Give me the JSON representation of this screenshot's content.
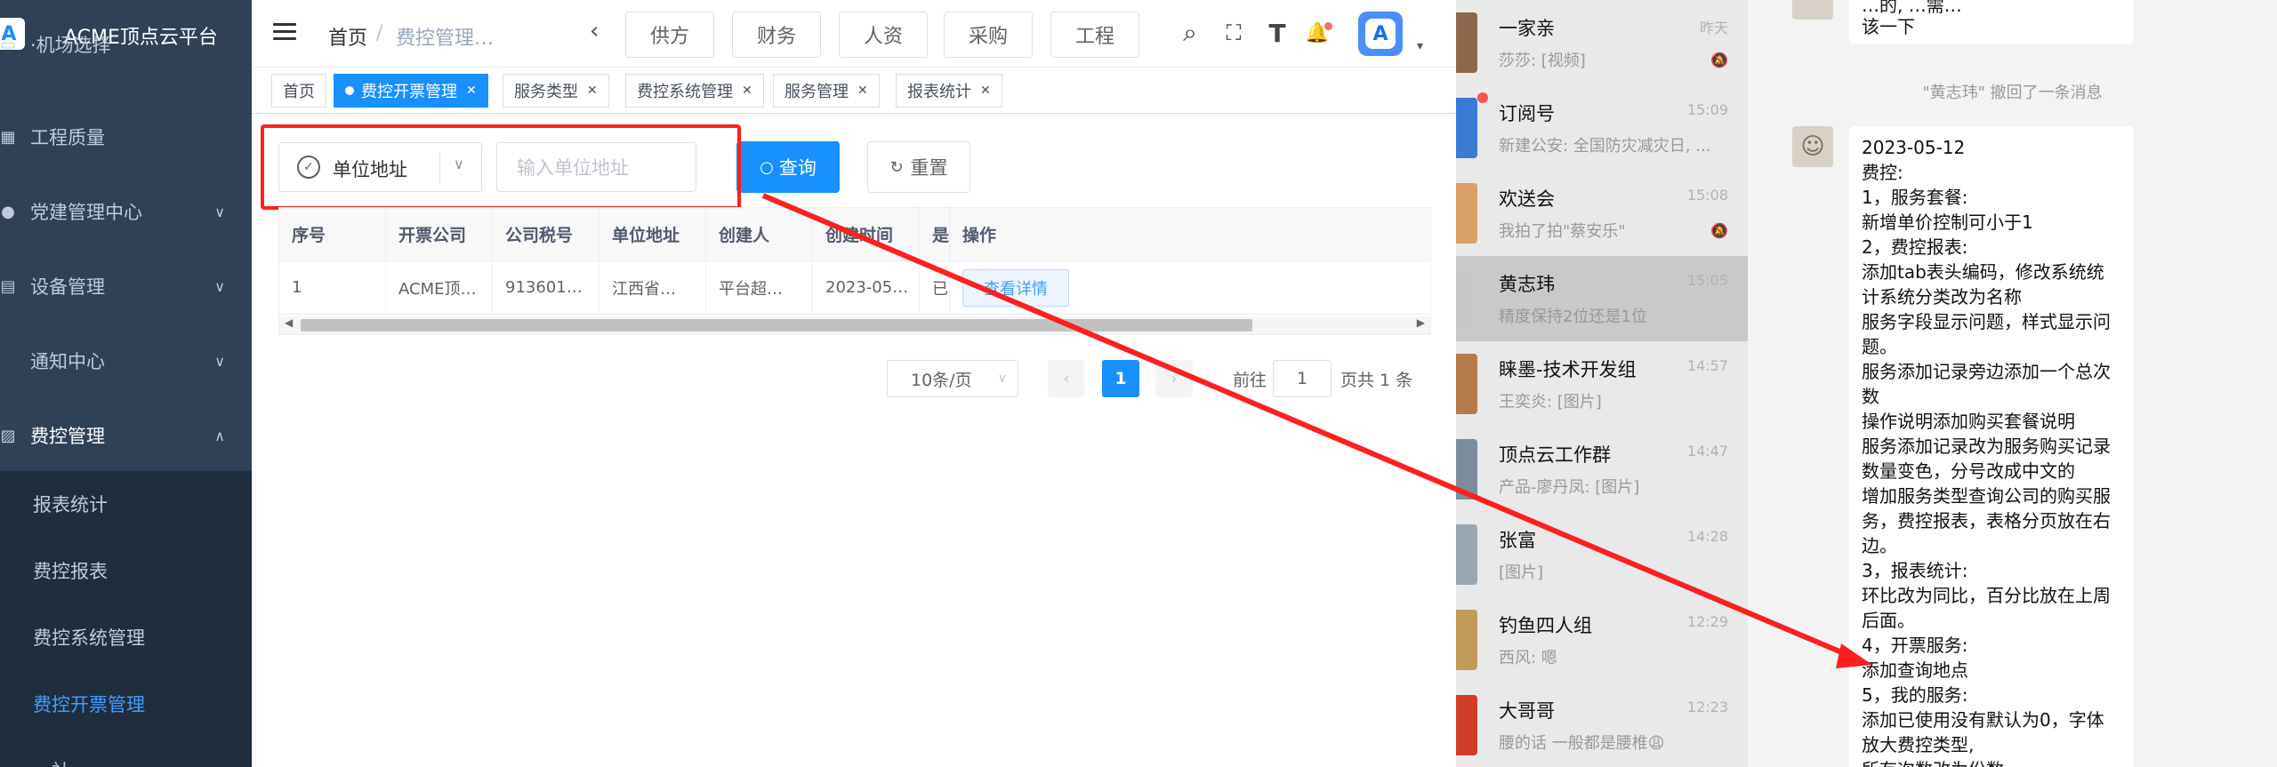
{
  "app": {
    "title": "ACME顶点云平台",
    "logo_text": "A"
  },
  "sidebar": {
    "items": [
      {
        "label": "·机场选择",
        "icon": "▭",
        "arrow": ""
      },
      {
        "label": "工程质量",
        "icon": "▦",
        "arrow": ""
      },
      {
        "label": "党建管理中心",
        "icon": "●",
        "arrow": "∨"
      },
      {
        "label": "设备管理",
        "icon": "▤",
        "arrow": "∨"
      },
      {
        "label": "通知中心",
        "icon": "",
        "arrow": "∨"
      },
      {
        "label": "费控管理",
        "icon": "▨",
        "arrow": "∧"
      }
    ],
    "sub_items": [
      {
        "label": "报表统计"
      },
      {
        "label": "费控报表"
      },
      {
        "label": "费控系统管理"
      },
      {
        "label": "费控开票管理"
      },
      {
        "label": "…社"
      }
    ]
  },
  "navbar": {
    "breadcrumb": [
      "首页",
      "/",
      "费控管理…"
    ],
    "back": "‹",
    "top_buttons": [
      "供方",
      "财务",
      "人资",
      "采购",
      "工程"
    ],
    "icons": {
      "search": "⌕",
      "fullscreen": "⛶",
      "font": "T",
      "bell": "🔔"
    },
    "avatar_text": "A",
    "caret": "▾"
  },
  "tags": [
    {
      "label": "首页",
      "closable": false,
      "active": false
    },
    {
      "label": "费控开票管理",
      "closable": true,
      "active": true
    },
    {
      "label": "服务类型",
      "closable": true,
      "active": false
    },
    {
      "label": "费控系统管理",
      "closable": true,
      "active": false
    },
    {
      "label": "服务管理",
      "closable": true,
      "active": false
    },
    {
      "label": "报表统计",
      "closable": true,
      "active": false
    }
  ],
  "search": {
    "field_label": "单位地址",
    "placeholder": "输入单位地址",
    "query_label": "查询",
    "reset_label": "重置"
  },
  "table": {
    "columns": [
      "序号",
      "开票公司",
      "公司税号",
      "单位地址",
      "创建人",
      "创建时间",
      "是",
      "操作"
    ],
    "rows": [
      {
        "cells": [
          "1",
          "ACME顶…",
          "913601…",
          "江西省…",
          "平台超…",
          "2023-05…",
          "已"
        ],
        "action": "查看详情"
      }
    ]
  },
  "pagination": {
    "page_size": "10条/页",
    "prev": "‹",
    "current": "1",
    "next": "›",
    "goto_prefix": "前往",
    "goto_value": "1",
    "goto_suffix": "页共 1 条"
  },
  "chat_list": [
    {
      "name": "一家亲",
      "msg": "莎莎: [视频]",
      "time": "昨天",
      "muted": true,
      "color": "#8a6a4a"
    },
    {
      "name": "订阅号",
      "msg": "新建公安: 全国防灾减灾日, ...",
      "time": "15:09",
      "muted": false,
      "badge": true,
      "color": "#3a7bd5"
    },
    {
      "name": "欢送会",
      "msg": "我拍了拍\"蔡安乐\"",
      "time": "15:08",
      "muted": true,
      "color": "#d9a06a"
    },
    {
      "name": "黄志玮",
      "msg": "精度保持2位还是1位",
      "time": "15:05",
      "muted": false,
      "selected": true,
      "color": "#c8c8c8"
    },
    {
      "name": "睐墨-技术开发组",
      "msg": "王奕炎: [图片]",
      "time": "14:57",
      "muted": false,
      "color": "#b57b4a"
    },
    {
      "name": "顶点云工作群",
      "msg": "产品-廖丹凤: [图片]",
      "time": "14:47",
      "muted": false,
      "color": "#7c8c9c"
    },
    {
      "name": "张富",
      "msg": "[图片]",
      "time": "14:28",
      "muted": false,
      "color": "#9aa7b0"
    },
    {
      "name": "钓鱼四人组",
      "msg": "西风: 嗯",
      "time": "12:29",
      "muted": false,
      "color": "#c29a5a"
    },
    {
      "name": "大哥哥",
      "msg": "腰的话 一般都是腰椎😩",
      "time": "12:23",
      "muted": false,
      "color": "#d23c2a"
    }
  ],
  "chat_window": {
    "top_bubble": "…一下",
    "top_bubble_lines": [
      "…的, …需…",
      "该一下"
    ],
    "recall_notice": "\"黄志玮\" 撤回了一条消息",
    "message_lines": [
      "2023-05-12",
      "费控:",
      "1，服务套餐:",
      "新增单价控制可小于1",
      "2，费控报表:",
      "添加tab表头编码，修改系统统计系统分类改为名称",
      "服务字段显示问题，样式显示问题。",
      "服务添加记录旁边添加一个总次数",
      "操作说明添加购买套餐说明",
      "服务添加记录改为服务购买记录数量变色，分号改成中文的",
      "增加服务类型查询公司的购买服务，费控报表，表格分页放在右边。",
      "3，报表统计:",
      "环比改为同比，百分比放在上周后面。",
      "4，开票服务:",
      "添加查询地点",
      "5，我的服务:",
      "添加已使用没有默认为0，字体放大费控类型,",
      "所有次数改为份数"
    ]
  },
  "annotation": {
    "color": "#ff1f1f"
  }
}
